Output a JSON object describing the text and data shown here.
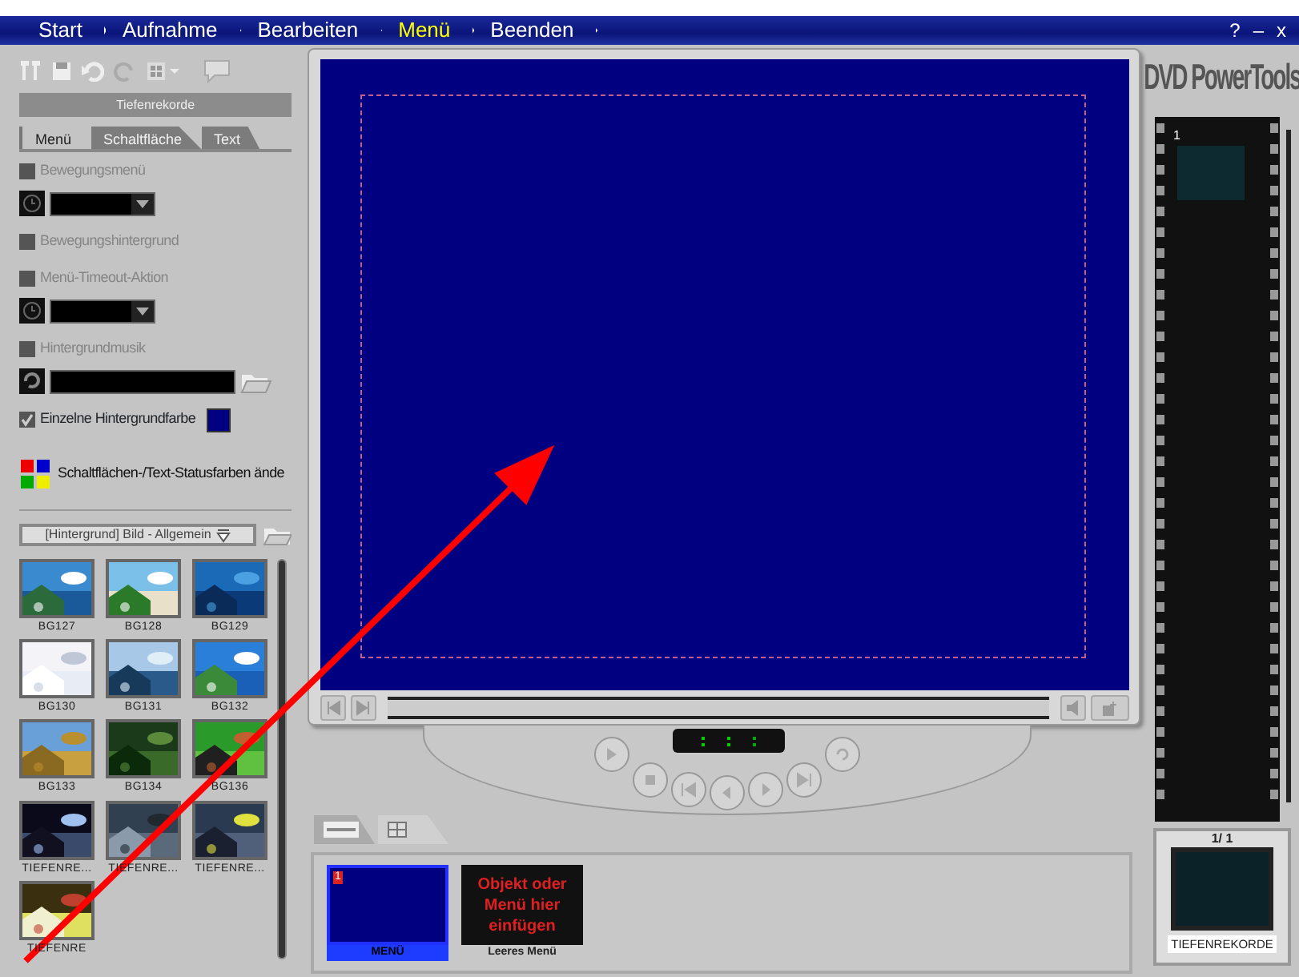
{
  "steps": [
    {
      "label": "Start",
      "selected": false
    },
    {
      "label": "Aufnahme",
      "selected": false
    },
    {
      "label": "Bearbeiten",
      "selected": false
    },
    {
      "label": "Menü",
      "selected": true
    },
    {
      "label": "Beenden",
      "selected": false
    }
  ],
  "window_buttons": [
    "?",
    "–",
    "x"
  ],
  "panel_title": "Tiefenrekorde",
  "tabs": [
    {
      "label": "Menü",
      "selected": true
    },
    {
      "label": "Schaltfläche",
      "selected": false
    },
    {
      "label": "Text",
      "selected": false
    }
  ],
  "settings": [
    {
      "kind": "checkbox",
      "label": "Bewegungsmenü",
      "checked": false,
      "disabled": true
    },
    {
      "kind": "select"
    },
    {
      "kind": "checkbox",
      "label": "Bewegungshintergrund",
      "checked": false,
      "disabled": true
    },
    {
      "kind": "checkbox",
      "label": "Menü-Timeout-Aktion",
      "checked": false,
      "disabled": true
    },
    {
      "kind": "select"
    },
    {
      "kind": "checkbox",
      "label": "Hintergrundmusik",
      "checked": false,
      "disabled": true
    },
    {
      "kind": "file"
    },
    {
      "kind": "color",
      "label": "Einzelne Hintergrundfarbe",
      "checked": true,
      "disabled": false,
      "color": "#000080"
    },
    {
      "kind": "button",
      "label": "Schaltflächen-/Text-Statusfarben ände"
    }
  ],
  "library": {
    "category": "[Hintergrund] Bild - Allgemein",
    "items": [
      {
        "label": "BG127"
      },
      {
        "label": "BG128"
      },
      {
        "label": "BG129"
      },
      {
        "label": "BG130"
      },
      {
        "label": "BG131"
      },
      {
        "label": "BG132"
      },
      {
        "label": "BG133"
      },
      {
        "label": "BG134"
      },
      {
        "label": "BG136"
      },
      {
        "label": "TIEFENRE..."
      },
      {
        "label": "TIEFENRE..."
      },
      {
        "label": "TIEFENRE..."
      },
      {
        "label": "TIEFENRE"
      }
    ]
  },
  "bin_items": [
    {
      "kind": "menu",
      "badge": "1",
      "label": "MENÜ",
      "selected": true
    },
    {
      "kind": "empty",
      "text": "Objekt oder Menü hier einfügen",
      "label": "Leeres Menü",
      "selected": false
    }
  ],
  "bottom_tabs": [
    {
      "selected": false
    },
    {
      "selected": true
    }
  ],
  "filmstrip": {
    "frame_number": "1"
  },
  "logo": "DVD PowerTools",
  "counter": "1/ 1",
  "thumbnail_label": "TIEFENREKORDE"
}
